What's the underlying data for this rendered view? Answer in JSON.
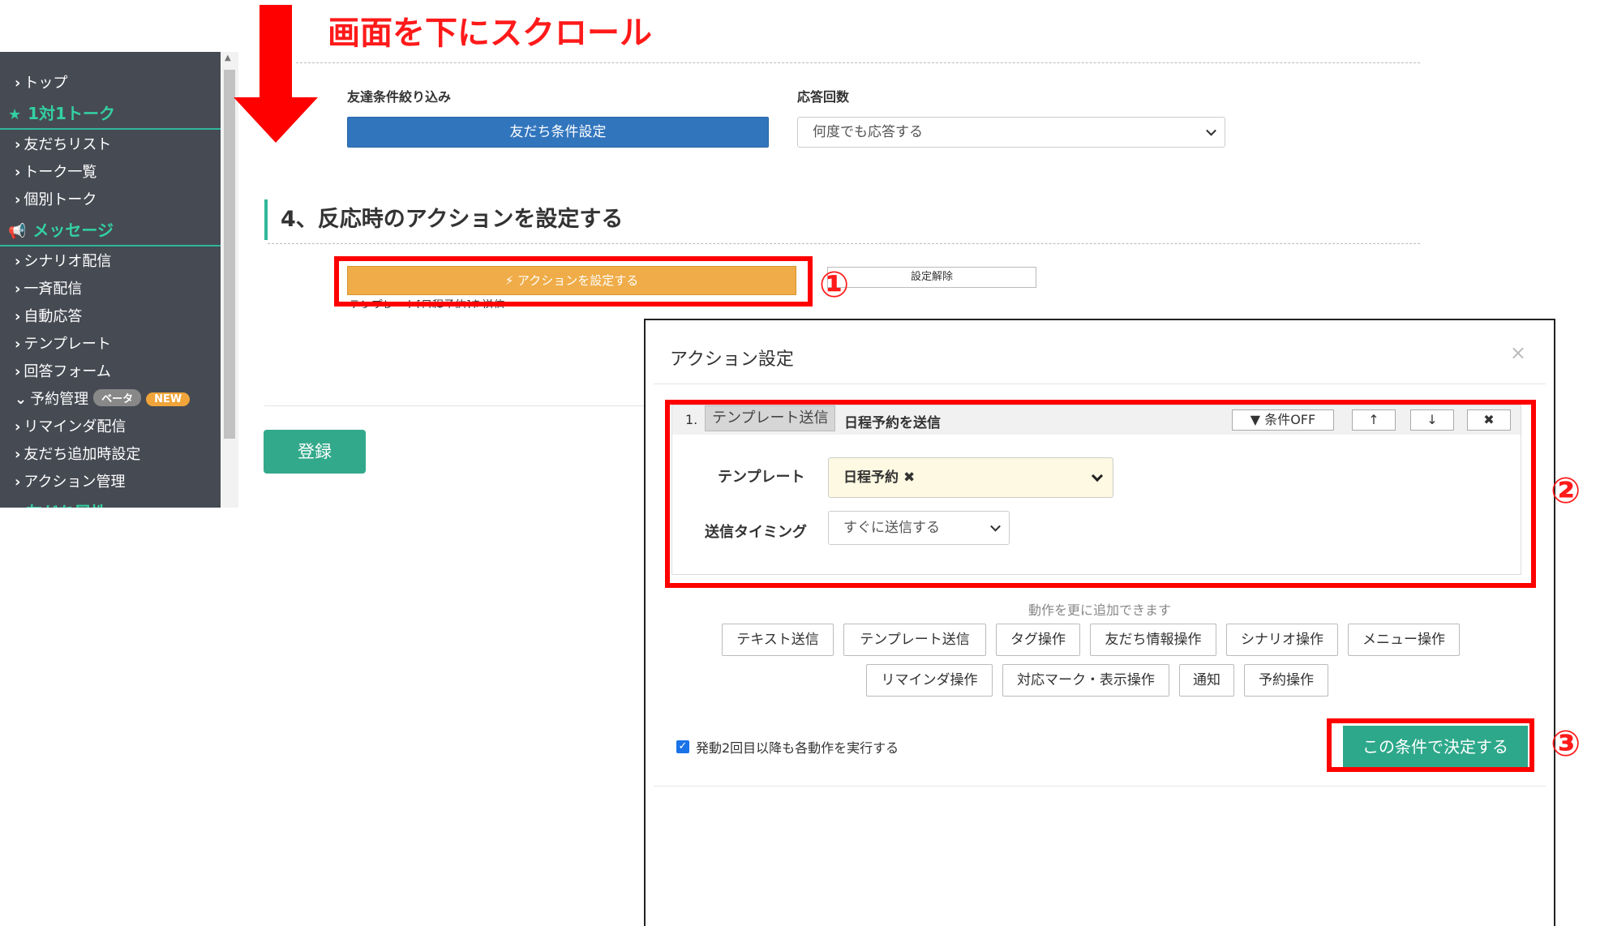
{
  "annotation": {
    "scroll_note": "画面を下にスクロール",
    "num1": "①",
    "num2": "②",
    "num3": "③"
  },
  "sidebar": {
    "items": [
      {
        "label": "トップ",
        "type": "item"
      },
      {
        "label": "1対1トーク",
        "type": "head",
        "icon": "star-icon"
      },
      {
        "label": "友だちリスト",
        "type": "item"
      },
      {
        "label": "トーク一覧",
        "type": "item"
      },
      {
        "label": "個別トーク",
        "type": "item"
      },
      {
        "label": "メッセージ",
        "type": "head",
        "icon": "megaphone-icon"
      },
      {
        "label": "シナリオ配信",
        "type": "item"
      },
      {
        "label": "一斉配信",
        "type": "item"
      },
      {
        "label": "自動応答",
        "type": "item"
      },
      {
        "label": "テンプレート",
        "type": "item"
      },
      {
        "label": "回答フォーム",
        "type": "item"
      },
      {
        "label": "予約管理",
        "type": "sub",
        "badge_beta": "ベータ",
        "badge_new": "NEW"
      },
      {
        "label": "リマインダ配信",
        "type": "item"
      },
      {
        "label": "友だち追加時設定",
        "type": "item"
      },
      {
        "label": "アクション管理",
        "type": "item"
      },
      {
        "label": "友だち属性",
        "type": "head",
        "icon": "filter-icon"
      }
    ]
  },
  "main": {
    "friend_filter_label": "友達条件絞り込み",
    "friend_filter_button": "友だち条件設定",
    "reply_count_label": "応答回数",
    "reply_count_value": "何度でも応答する",
    "section_title": "4、反応時のアクションを設定する",
    "action_button": "アクションを設定する",
    "clear_button": "設定解除",
    "action_summary": "テンプレート[日程予約]を送信",
    "register_button": "登録"
  },
  "modal": {
    "title": "アクション設定",
    "close": "×",
    "action": {
      "number": "1.",
      "type": "テンプレート送信",
      "name": "日程予約を送信",
      "condition_button": "条件OFF",
      "up": "↑",
      "down": "↓",
      "delete": "✖",
      "template_label": "テンプレート",
      "template_value": "日程予約",
      "template_clear": "✖",
      "timing_label": "送信タイミング",
      "timing_value": "すぐに送信する"
    },
    "add_note": "動作を更に追加できます",
    "add_buttons_row1": [
      "テキスト送信",
      "テンプレート送信",
      "タグ操作",
      "友だち情報操作",
      "シナリオ操作",
      "メニュー操作"
    ],
    "add_buttons_row2": [
      "リマインダ操作",
      "対応マーク・表示操作",
      "通知",
      "予約操作"
    ],
    "repeat_label": "発動2回目以降も各動作を実行する",
    "repeat_checked": true,
    "confirm_button": "この条件で決定する"
  }
}
